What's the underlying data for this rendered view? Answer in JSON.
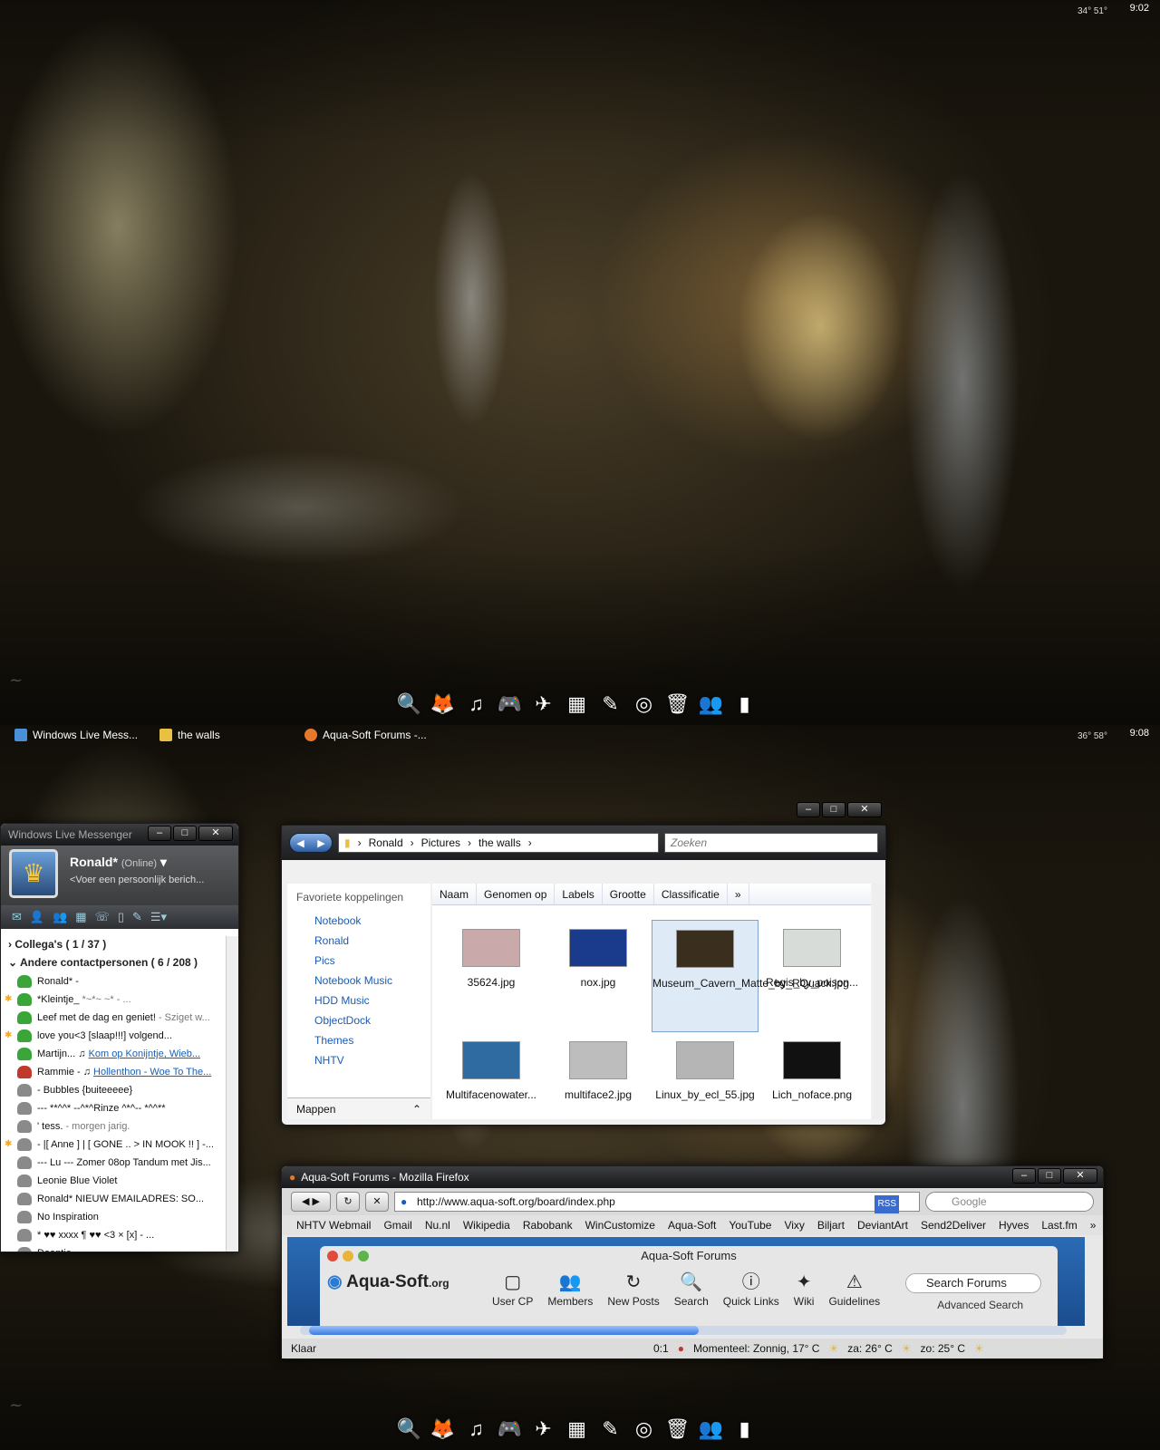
{
  "screen1": {
    "temperature": "34° 51°",
    "clock": "9:02"
  },
  "screen2": {
    "temperature": "36° 58°",
    "clock": "9:08",
    "taskbar": [
      {
        "label": "Windows Live Mess..."
      },
      {
        "label": "the walls"
      },
      {
        "label": "Aqua-Soft Forums -..."
      }
    ]
  },
  "dock": {
    "icons": [
      "magnifier-icon",
      "firefox-icon",
      "itunes-icon",
      "gamepad-icon",
      "network-icon",
      "office-icon",
      "pen-icon",
      "disc-icon",
      "recycle-bin-icon",
      "messenger-icon",
      "battery-icon"
    ]
  },
  "messenger": {
    "title": "Windows Live Messenger",
    "user_name": "Ronald*",
    "status": "(Online)",
    "personal_message": "<Voer een persoonlijk berich...",
    "groups": [
      {
        "label": "Collega's ( 1 / 37 )"
      },
      {
        "label": "Andere contactpersonen ( 6 / 208 )"
      }
    ],
    "contacts": [
      {
        "name": "Ronald* -",
        "status_color": "#3aa63a"
      },
      {
        "name": "*Kleintje_",
        "extra": "*~*~ ~* - ...",
        "status_color": "#3aa63a",
        "star": true
      },
      {
        "name": "Leef met de dag en geniet!",
        "extra": "- Sziget w...",
        "status_color": "#3aa63a"
      },
      {
        "name": "love you<3        [slaap!!!]  volgend...",
        "status_color": "#3aa63a",
        "star": true
      },
      {
        "name": "Martijn...",
        "link": "Kom op Konijntje, Wieb...",
        "status_color": "#3aa63a"
      },
      {
        "name": "Rammie -",
        "link": "Hollenthon - Woe To The...",
        "status_color": "#c0392b"
      },
      {
        "name": "-          Bubbles {buiteeeee}",
        "status_color": "#8a8a8a"
      },
      {
        "name": "---     **^^* --^*^Rinze ^*^-- *^^**",
        "status_color": "#8a8a8a"
      },
      {
        "name": "'  tess.",
        "extra": "- morgen jarig.",
        "status_color": "#8a8a8a"
      },
      {
        "name": "- |[ Anne ] | [ GONE .. > IN MOOK !! ] -...",
        "status_color": "#8a8a8a",
        "star": true
      },
      {
        "name": "--- Lu ---    Zomer 08op Tandum met Jis...",
        "status_color": "#8a8a8a"
      },
      {
        "name": "Leonie      Blue Violet",
        "status_color": "#8a8a8a"
      },
      {
        "name": "Ronald* NIEUW EMAILADRES: SO...",
        "status_color": "#8a8a8a"
      },
      {
        "name": "No Inspiration",
        "status_color": "#8a8a8a"
      },
      {
        "name": "* ♥♥ xxxx  ¶ ♥♥   <3  ×  [x] - ...",
        "status_color": "#8a8a8a"
      },
      {
        "name": "Daantje",
        "status_color": "#8a8a8a"
      }
    ]
  },
  "explorer": {
    "breadcrumb": [
      "Ronald",
      "Pictures",
      "the walls"
    ],
    "search_placeholder": "Zoeken",
    "favorites_header": "Favoriete koppelingen",
    "favorites": [
      "Notebook",
      "Ronald",
      "Pics",
      "Notebook Music",
      "HDD Music",
      "ObjectDock",
      "Themes",
      "NHTV"
    ],
    "folders_label": "Mappen",
    "columns": [
      "Naam",
      "Genomen op",
      "Labels",
      "Grootte",
      "Classificatie"
    ],
    "files": [
      {
        "name": "35624.jpg",
        "color": "#c9a9a9"
      },
      {
        "name": "nox.jpg",
        "color": "#1a3b8c"
      },
      {
        "name": "Museum_Cavern_Matte_by_RQuack.jpg",
        "color": "#3a2e1e",
        "selected": true
      },
      {
        "name": "Regis_by_poison...",
        "color": "#d8dcd8"
      },
      {
        "name": "Multifacenowater...",
        "color": "#2f6aa0"
      },
      {
        "name": "multiface2.jpg",
        "color": "#bdbdbd"
      },
      {
        "name": "Linux_by_ecl_55.jpg",
        "color": "#b5b5b5"
      },
      {
        "name": "Lich_noface.png",
        "color": "#111111"
      }
    ]
  },
  "firefox": {
    "title": "Aqua-Soft Forums - Mozilla Firefox",
    "url": "http://www.aqua-soft.org/board/index.php",
    "rss": "RSS",
    "search_engine": "Google",
    "bookmarks": [
      "NHTV Webmail",
      "Gmail",
      "Nu.nl",
      "Wikipedia",
      "Rabobank",
      "WinCustomize",
      "Aqua-Soft",
      "YouTube",
      "Vixy",
      "Biljart",
      "DeviantArt",
      "Send2Deliver",
      "Hyves",
      "Last.fm"
    ],
    "status": "Klaar",
    "counter": "0:1",
    "weather": [
      "Momenteel: Zonnig, 17° C",
      "za: 26° C",
      "zo: 25° C"
    ],
    "page": {
      "window_title": "Aqua-Soft Forums",
      "logo": "Aqua-Soft",
      "logo_suffix": ".org",
      "nav": [
        "User CP",
        "Members",
        "New Posts",
        "Search",
        "Quick Links",
        "Wiki",
        "Guidelines"
      ],
      "search_placeholder": "Search Forums",
      "advanced_search": "Advanced Search"
    }
  }
}
